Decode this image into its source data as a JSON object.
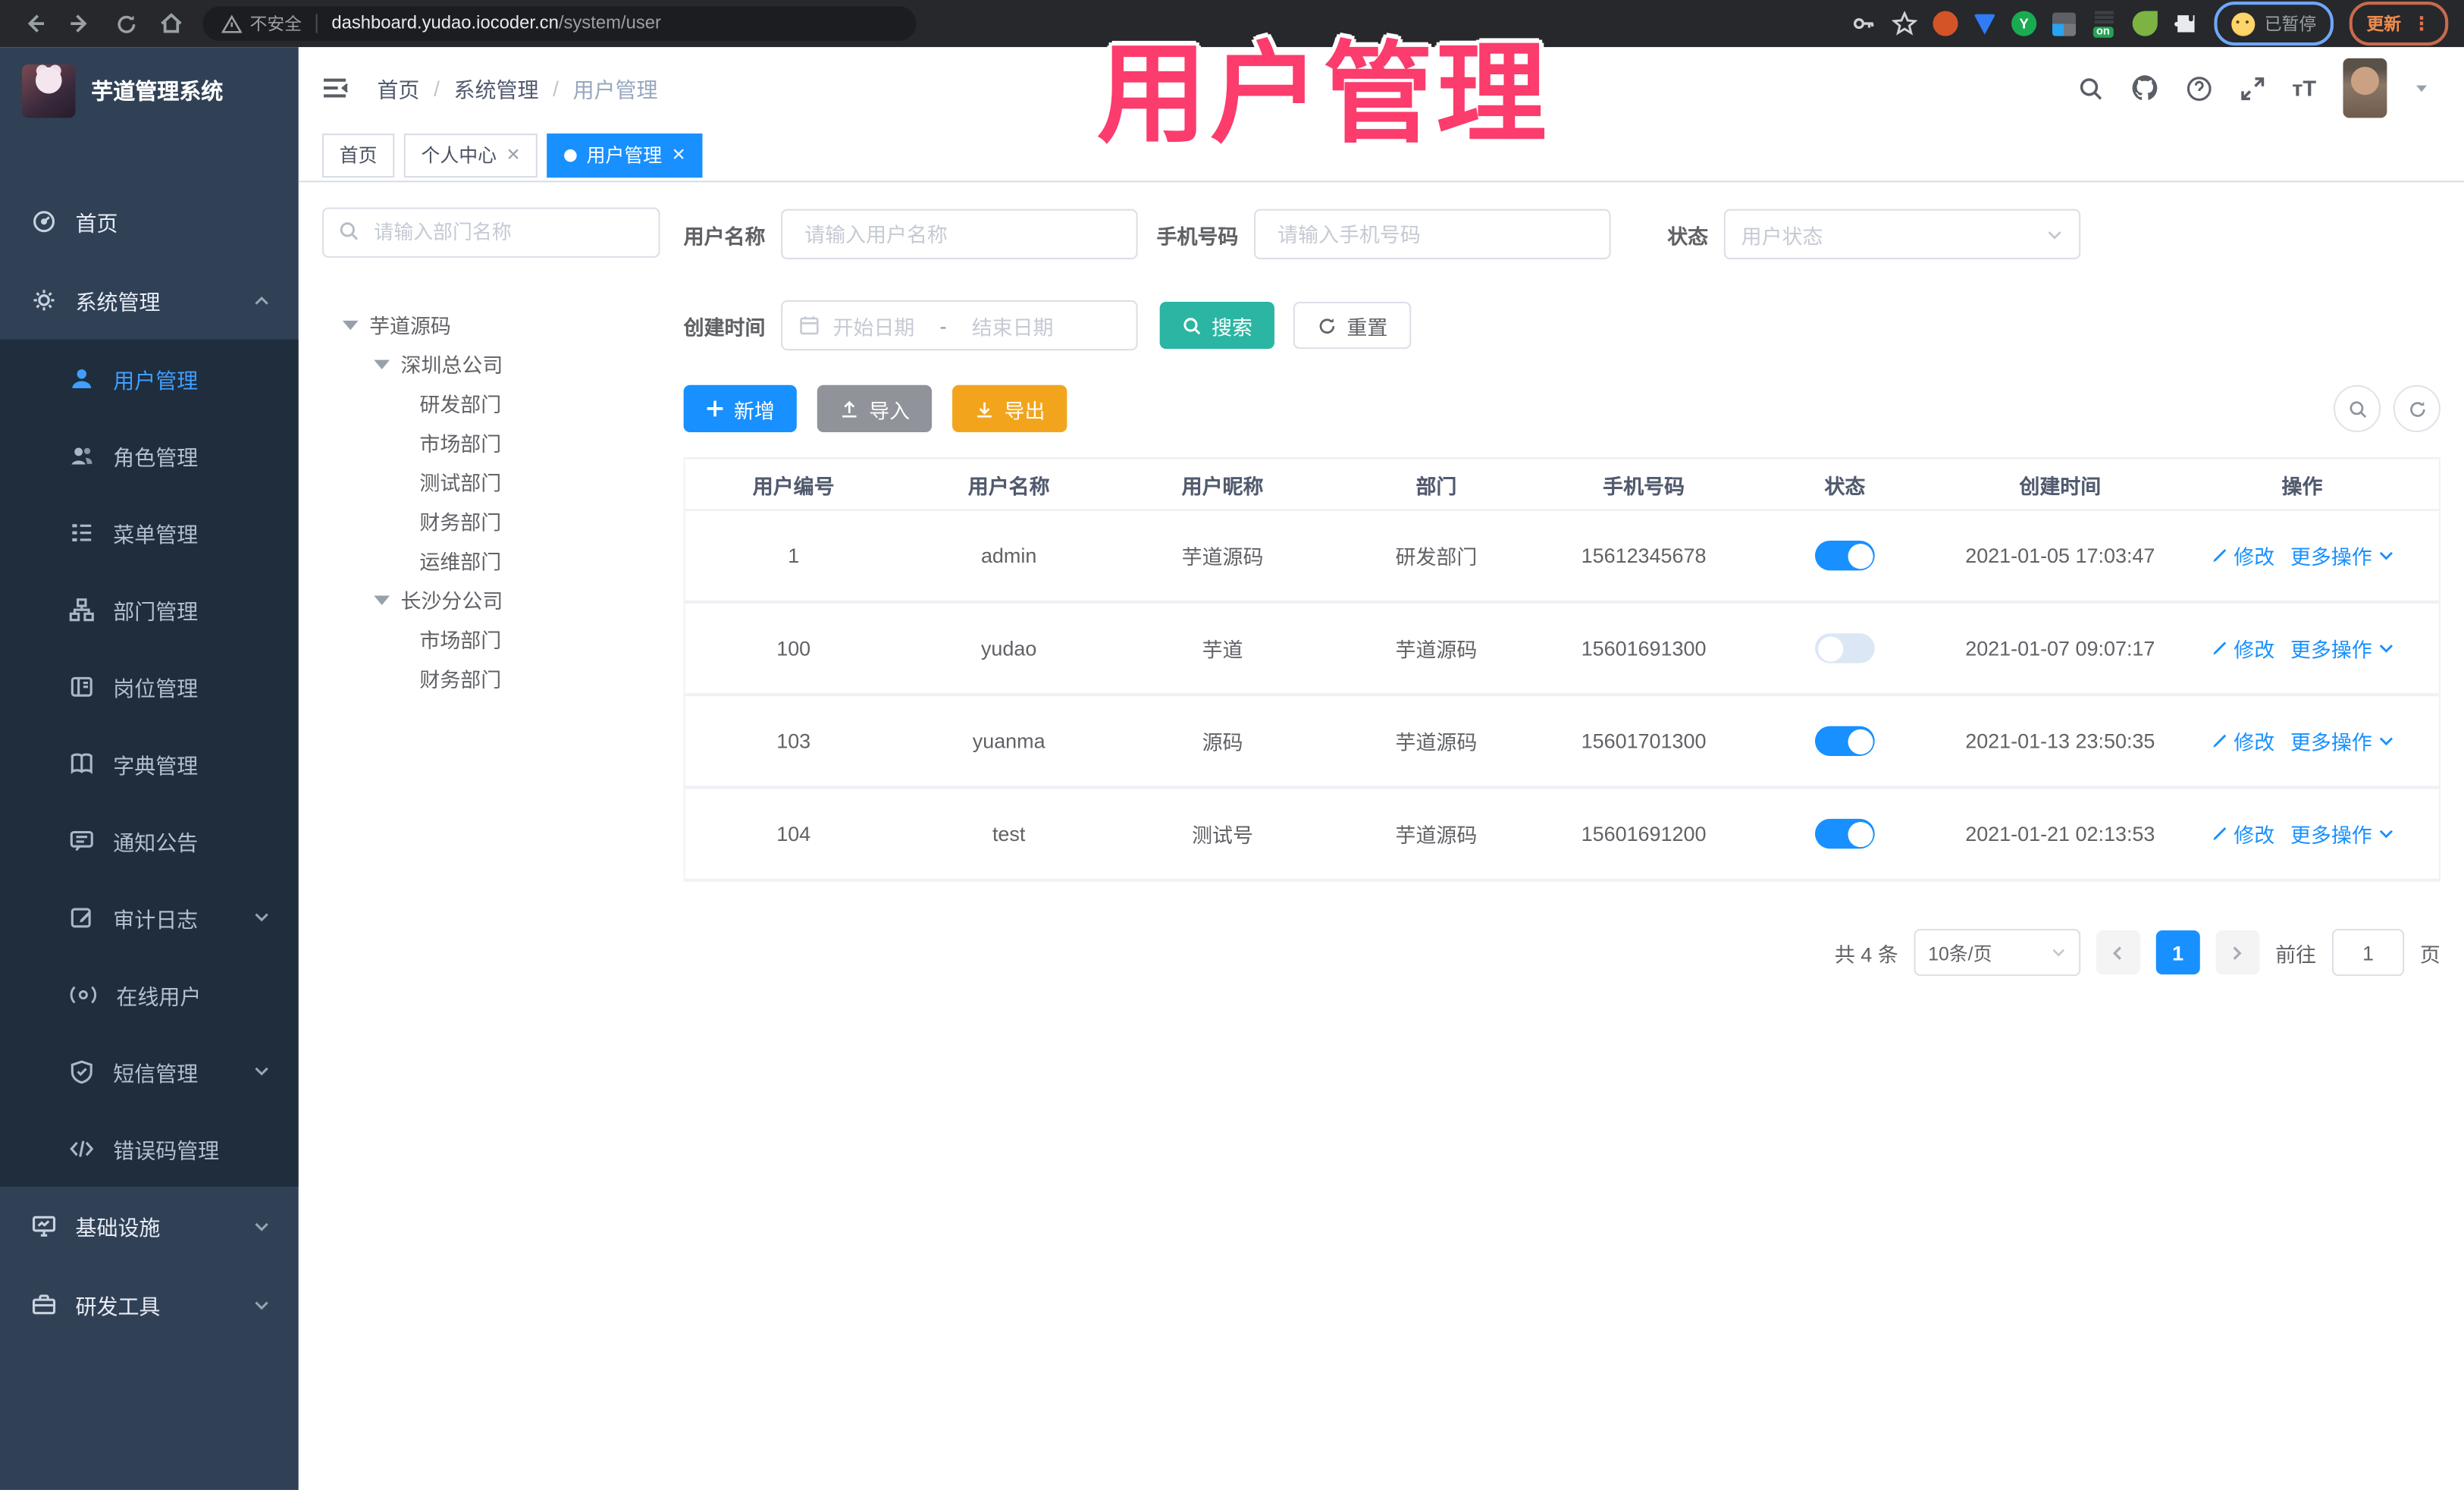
{
  "browser": {
    "security_label": "不安全",
    "url_host": "dashboard.yudao.iocoder.cn",
    "url_path": "/system/user",
    "profile_badge": "已暂停",
    "update_button": "更新"
  },
  "overlay": {
    "title": "用户管理"
  },
  "app": {
    "logo_title": "芋道管理系统",
    "breadcrumb": [
      "首页",
      "系统管理",
      "用户管理"
    ],
    "tabs": [
      {
        "label": "首页"
      },
      {
        "label": "个人中心"
      },
      {
        "label": "用户管理"
      }
    ],
    "sidebar": {
      "items": [
        {
          "label": "首页"
        },
        {
          "label": "系统管理"
        },
        {
          "label": "用户管理"
        },
        {
          "label": "角色管理"
        },
        {
          "label": "菜单管理"
        },
        {
          "label": "部门管理"
        },
        {
          "label": "岗位管理"
        },
        {
          "label": "字典管理"
        },
        {
          "label": "通知公告"
        },
        {
          "label": "审计日志"
        },
        {
          "label": "在线用户"
        },
        {
          "label": "短信管理"
        },
        {
          "label": "错误码管理"
        },
        {
          "label": "基础设施"
        },
        {
          "label": "研发工具"
        }
      ]
    }
  },
  "dept_panel": {
    "search_placeholder": "请输入部门名称",
    "tree": [
      {
        "label": "芋道源码"
      },
      {
        "label": "深圳总公司"
      },
      {
        "label": "研发部门"
      },
      {
        "label": "市场部门"
      },
      {
        "label": "测试部门"
      },
      {
        "label": "财务部门"
      },
      {
        "label": "运维部门"
      },
      {
        "label": "长沙分公司"
      },
      {
        "label": "市场部门"
      },
      {
        "label": "财务部门"
      }
    ]
  },
  "filters": {
    "username_label": "用户名称",
    "username_placeholder": "请输入用户名称",
    "mobile_label": "手机号码",
    "mobile_placeholder": "请输入手机号码",
    "status_label": "状态",
    "status_placeholder": "用户状态",
    "create_time_label": "创建时间",
    "date_start_placeholder": "开始日期",
    "date_separator": "-",
    "date_end_placeholder": "结束日期",
    "search_button": "搜索",
    "reset_button": "重置"
  },
  "toolbar": {
    "add_label": "新增",
    "import_label": "导入",
    "export_label": "导出"
  },
  "table": {
    "headers": [
      "用户编号",
      "用户名称",
      "用户昵称",
      "部门",
      "手机号码",
      "状态",
      "创建时间",
      "操作"
    ],
    "edit_label": "修改",
    "more_label": "更多操作",
    "rows": [
      {
        "id": "1",
        "username": "admin",
        "nickname": "芋道源码",
        "dept": "研发部门",
        "mobile": "15612345678",
        "status": "on",
        "created": "2021-01-05 17:03:47"
      },
      {
        "id": "100",
        "username": "yudao",
        "nickname": "芋道",
        "dept": "芋道源码",
        "mobile": "15601691300",
        "status": "off",
        "created": "2021-01-07 09:07:17"
      },
      {
        "id": "103",
        "username": "yuanma",
        "nickname": "源码",
        "dept": "芋道源码",
        "mobile": "15601701300",
        "status": "on",
        "created": "2021-01-13 23:50:35"
      },
      {
        "id": "104",
        "username": "test",
        "nickname": "测试号",
        "dept": "芋道源码",
        "mobile": "15601691200",
        "status": "on",
        "created": "2021-01-21 02:13:53"
      }
    ]
  },
  "pagination": {
    "total_text": "共 4 条",
    "page_size": "10条/页",
    "current_page": "1",
    "goto_label": "前往",
    "goto_value": "1",
    "page_suffix": "页"
  }
}
